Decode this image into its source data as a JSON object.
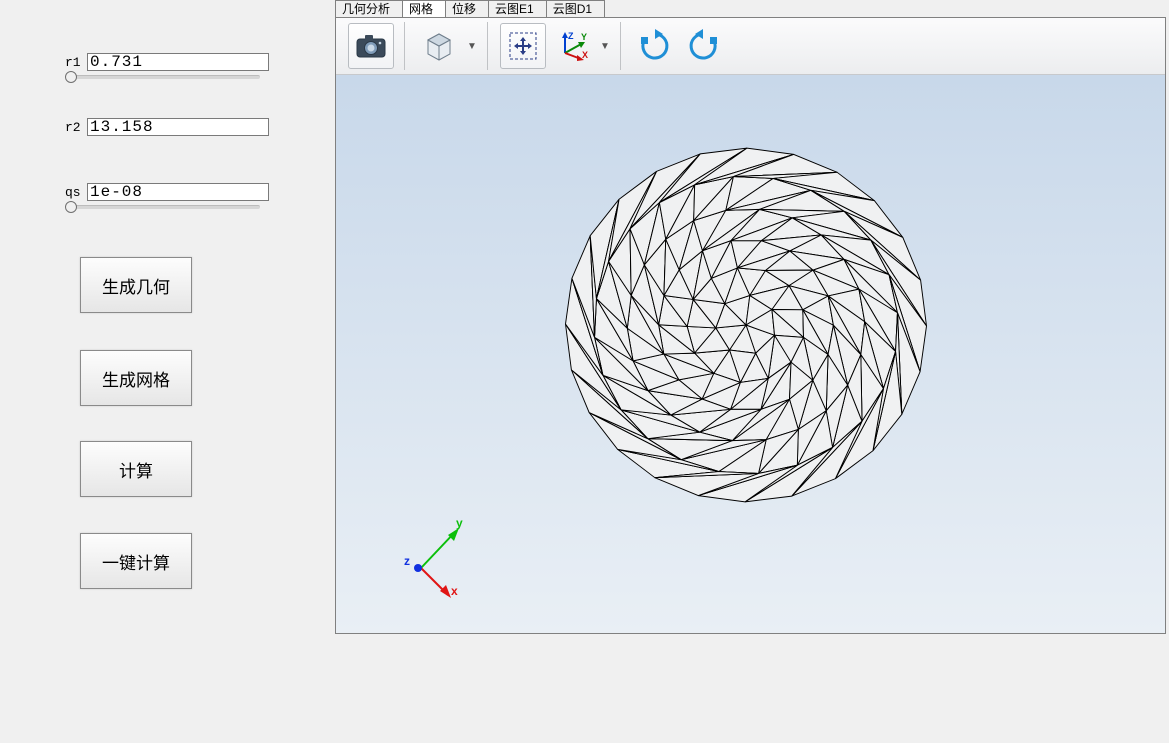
{
  "params": {
    "r1": {
      "label": "r1",
      "value": "0.731",
      "thumb_pct": 1
    },
    "r2": {
      "label": "r2",
      "value": "13.158"
    },
    "qs": {
      "label": "qs",
      "value": "1e-08",
      "thumb_pct": 1
    }
  },
  "buttons": {
    "gen_geom": "生成几何",
    "gen_mesh": "生成网格",
    "compute": "计算",
    "one_click": "一键计算"
  },
  "tabs": {
    "items": [
      "几何分析",
      "网格",
      "位移",
      "云图E1",
      "云图D1"
    ],
    "active_index": 1
  },
  "toolbar": {
    "screenshot": "screenshot",
    "box": "view-box",
    "box_drop": "▼",
    "move": "fit-move",
    "axes": "axes-triad",
    "axes_drop": "▼",
    "rotate_cw": "rotate-right",
    "rotate_ccw": "rotate-left"
  },
  "triad_labels": {
    "x": "x",
    "y": "y",
    "z": "z"
  }
}
